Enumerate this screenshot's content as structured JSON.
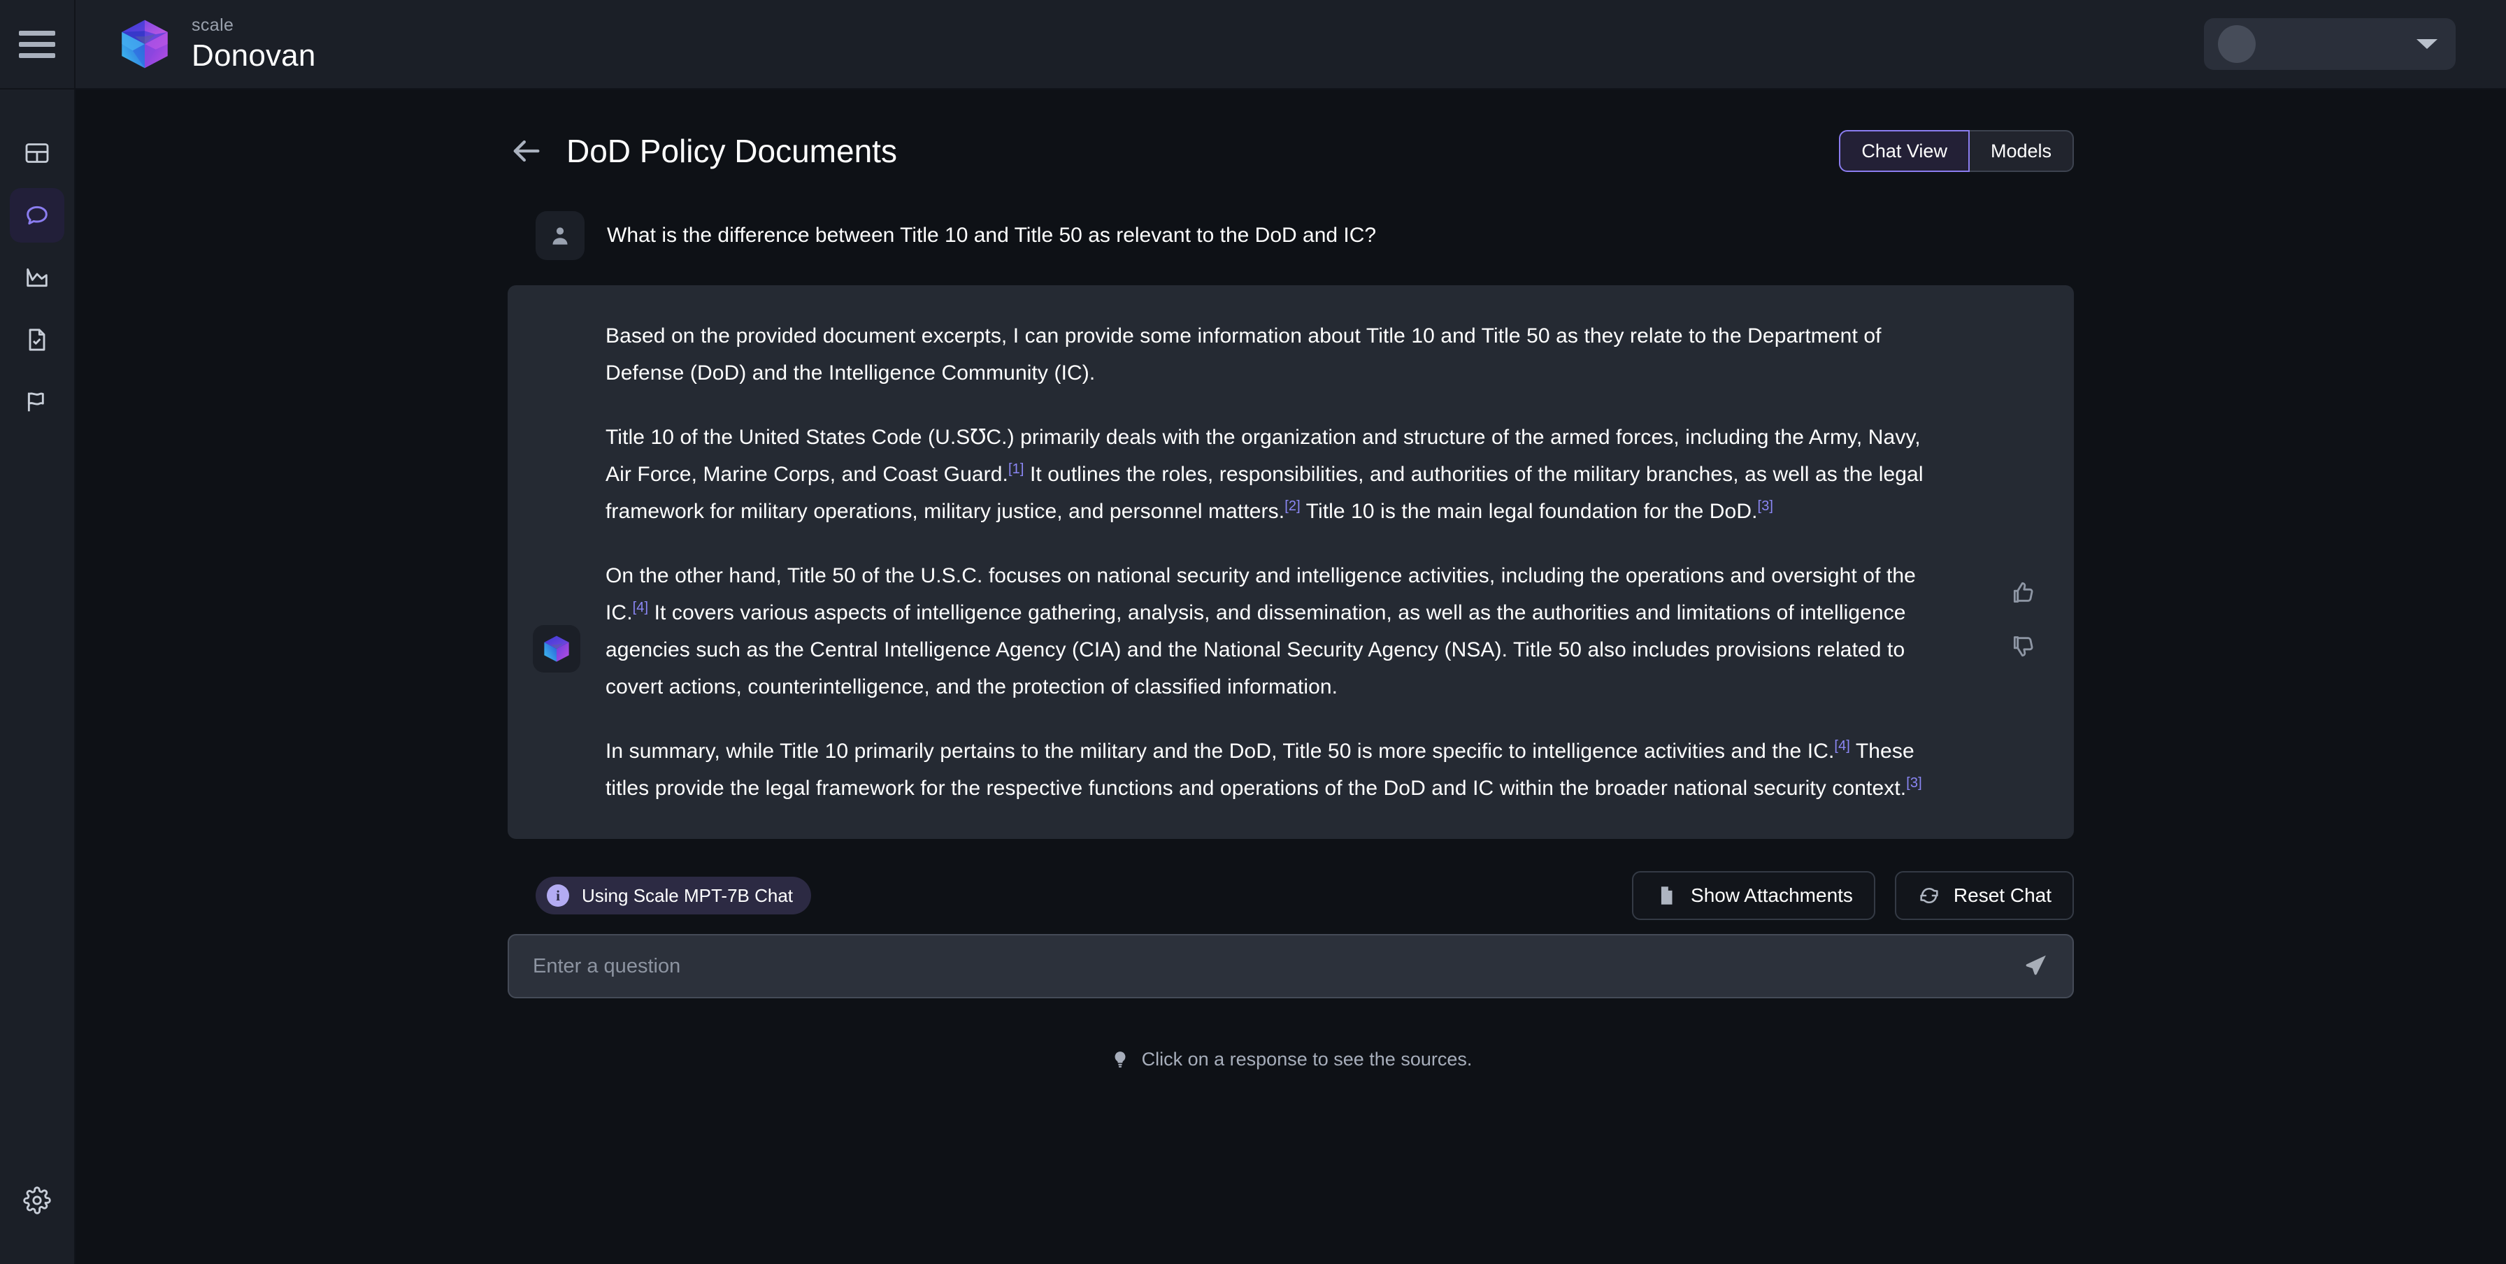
{
  "topbar": {
    "menu_icon": "hamburger-menu-icon",
    "brand_small": "scale",
    "brand_name": "Donovan",
    "logo_icon": "scale-donovan-cube-logo",
    "account": {
      "avatar_icon": "user-avatar-placeholder",
      "caret_icon": "chevron-down-icon"
    }
  },
  "sidebar": {
    "items": [
      {
        "name": "dashboard",
        "icon": "grid-dashboard-icon",
        "active": false
      },
      {
        "name": "chat",
        "icon": "chat-bubble-icon",
        "active": true
      },
      {
        "name": "analytics",
        "icon": "bar-chart-icon",
        "active": false
      },
      {
        "name": "documents",
        "icon": "document-check-icon",
        "active": false
      },
      {
        "name": "flags",
        "icon": "flag-icon",
        "active": false
      }
    ],
    "bottom_item": {
      "name": "settings",
      "icon": "gear-icon"
    }
  },
  "header": {
    "back_icon": "arrow-left-icon",
    "title": "DoD Policy Documents",
    "view_toggle": {
      "options": [
        "Chat View",
        "Models"
      ],
      "selected": "Chat View"
    }
  },
  "conversation": {
    "user": {
      "avatar_icon": "person-icon",
      "message": "What is the difference between Title 10 and Title 50 as relevant to the DoD and IC?"
    },
    "assistant": {
      "avatar_icon": "scale-donovan-cube-logo",
      "paragraphs": [
        {
          "id": "p1",
          "segments": [
            {
              "type": "text",
              "value": "Based on the provided document excerpts, I can provide some information about Title 10 and Title 50 as they relate to the Department of Defense (DoD) and the Intelligence Community (IC)."
            }
          ]
        },
        {
          "id": "p2",
          "segments": [
            {
              "type": "text",
              "value": "Title 10 of the United States Code (U.S℧C.) primarily deals with the organization and structure of the armed forces, including the Army, Navy, Air Force, Marine Corps, and Coast Guard."
            },
            {
              "type": "citation",
              "value": "[1]"
            },
            {
              "type": "text",
              "value": " It outlines the roles, responsibilities, and authorities of the military branches, as well as the legal framework for military operations, military justice, and personnel matters."
            },
            {
              "type": "citation",
              "value": "[2]"
            },
            {
              "type": "text",
              "value": " Title 10 is the main legal foundation for the DoD."
            },
            {
              "type": "citation",
              "value": "[3]"
            }
          ]
        },
        {
          "id": "p3",
          "segments": [
            {
              "type": "text",
              "value": "On the other hand, Title 50 of the U.S.C. focuses on national security and intelligence activities, including the operations and oversight of the IC."
            },
            {
              "type": "citation",
              "value": "[4]"
            },
            {
              "type": "text",
              "value": " It covers various aspects of intelligence gathering, analysis, and dissemination, as well as the authorities and limitations of intelligence agencies such as the Central Intelligence Agency (CIA) and the National Security Agency (NSA). Title 50 also includes provisions related to covert actions, counterintelligence, and the protection of classified information."
            }
          ]
        },
        {
          "id": "p4",
          "segments": [
            {
              "type": "text",
              "value": "In summary, while Title 10 primarily pertains to the military and the DoD, Title 50 is more specific to intelligence activities and the IC."
            },
            {
              "type": "citation",
              "value": "[4]"
            },
            {
              "type": "text",
              "value": " These titles provide the legal framework for the respective functions and operations of the DoD and IC within the broader national security context."
            },
            {
              "type": "citation",
              "value": "[3]"
            }
          ]
        }
      ],
      "feedback": {
        "thumbs_up_icon": "thumbs-up-icon",
        "thumbs_down_icon": "thumbs-down-icon"
      }
    }
  },
  "toolbar": {
    "model_badge": {
      "icon": "info-circle-icon",
      "label": "Using Scale MPT-7B Chat"
    },
    "show_attachments": {
      "icon": "document-icon",
      "label": "Show Attachments"
    },
    "reset_chat": {
      "icon": "refresh-icon",
      "label": "Reset Chat"
    }
  },
  "composer": {
    "placeholder": "Enter a question",
    "value": "",
    "send_icon": "send-paper-plane-icon"
  },
  "footer": {
    "icon": "lightbulb-icon",
    "hint": "Click on a response to see the sources."
  },
  "colors": {
    "accent_purple": "#8b7df0",
    "citation_purple": "#8b87f5",
    "page_bg": "#0e1116",
    "panel_bg": "#1b1f27",
    "card_bg": "#252a33"
  }
}
